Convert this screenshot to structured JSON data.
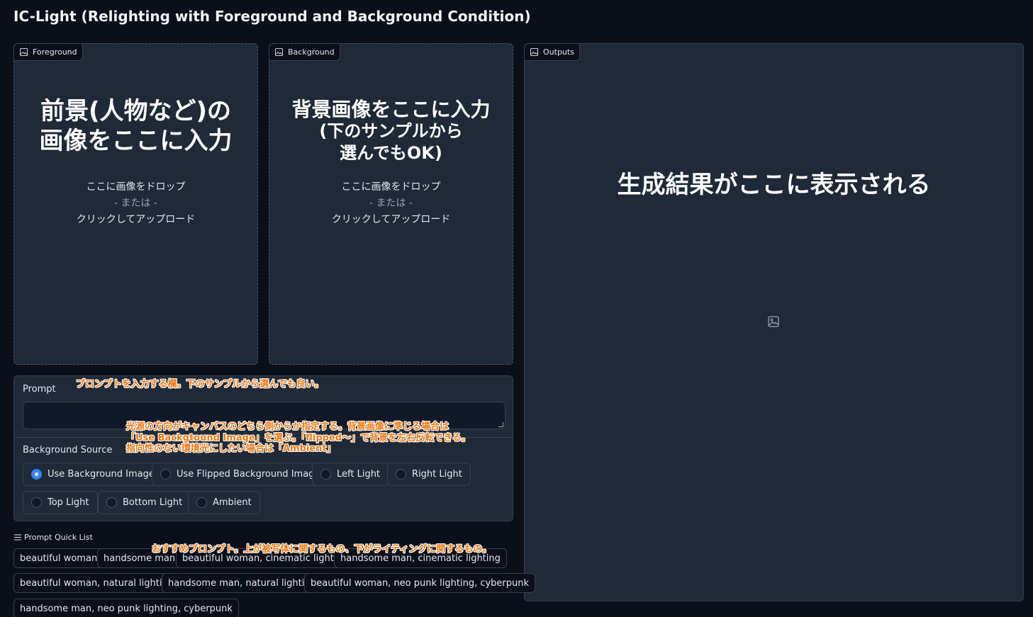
{
  "app": {
    "title": "IC-Light (Relighting with Foreground and Background Condition)"
  },
  "foreground": {
    "label": "Foreground",
    "caption_lines": [
      "前景(人物など)の",
      "画像をここに入力"
    ],
    "drop_text": "ここに画像をドロップ",
    "or_text": "- または -",
    "upload_text": "クリックしてアップロード"
  },
  "background": {
    "label": "Background",
    "caption_lines": [
      "背景画像をここに入力",
      "(下のサンプルから",
      "選んでもOK)"
    ],
    "drop_text": "ここに画像をドロップ",
    "or_text": "- または -",
    "upload_text": "クリックしてアップロード"
  },
  "outputs": {
    "label": "Outputs",
    "caption": "生成結果がここに表示される",
    "placeholder_icon": "image-icon"
  },
  "prompt": {
    "label": "Prompt",
    "value": "",
    "note": "プロンプトを入力する欄。下のサンプルから選んでも良い。"
  },
  "background_source": {
    "label": "Background Source",
    "selected": "Use Background Image",
    "options": [
      "Use Background Image",
      "Use Flipped Background Image",
      "Left Light",
      "Right Light",
      "Top Light",
      "Bottom Light",
      "Ambient"
    ],
    "note_lines": [
      "光源の方向がキャンバスのどちら側からか指定する。背景画像に準じる場合は",
      "「Use Backgtound Image」を選ぶ。「flipped〜」で背景を左右反転できる。",
      "指向性のない環境光にしたい場合は「Ambient」"
    ]
  },
  "quick_list": {
    "title": "Prompt Quick List",
    "icon": "list-icon",
    "items": [
      "beautiful woman",
      "handsome man",
      "beautiful woman, cinematic lighting",
      "handsome man, cinematic lighting",
      "beautiful woman, natural lighting",
      "handsome man, natural lighting",
      "beautiful woman, neo punk lighting, cyberpunk",
      "handsome man, neo punk lighting, cyberpunk"
    ],
    "note": "おすすめプロンプト。上が被写体に関するもの、下がライティングに関するもの。"
  },
  "colors": {
    "page_bg": "#0b0f19",
    "panel_bg": "#1f2937",
    "border": "#374151",
    "accent": "#3b82f6",
    "annotation": "#ef7a1a"
  }
}
